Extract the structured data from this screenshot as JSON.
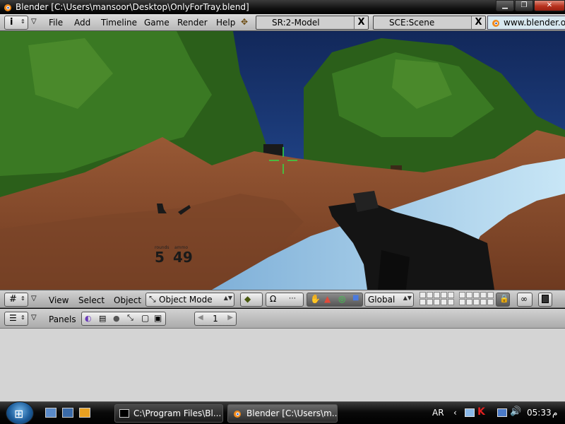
{
  "window": {
    "title": "Blender [C:\\Users\\mansoor\\Desktop\\OnlyForTray.blend]",
    "controls": [
      "minimize-icon",
      "maximize-icon",
      "close-icon"
    ]
  },
  "header": {
    "menus": [
      "File",
      "Add",
      "Timeline",
      "Game",
      "Render",
      "Help"
    ],
    "screen": "SR:2-Model",
    "scene": "SCE:Scene",
    "delete_glyph": "X",
    "url": "www.blender.org"
  },
  "viewport": {
    "hud": {
      "rounds_label": "rounds",
      "rounds_value": "5",
      "ammo_label": "ammo",
      "ammo_value": "49"
    },
    "colors": {
      "sky": "#1c3b7a",
      "tree": "#2f6a1c",
      "ground": "#8a4a2a",
      "water": "#a8d0ea",
      "crosshair": "#33dd44"
    }
  },
  "view3d_header": {
    "menus": [
      "View",
      "Select",
      "Object"
    ],
    "mode": "Object Mode",
    "orientation": "Global"
  },
  "buttons_header": {
    "panels_label": "Panels",
    "frame": "1"
  },
  "taskbar": {
    "tasks": [
      {
        "label": "C:\\Program Files\\Bl...",
        "icon": "terminal-icon"
      },
      {
        "label": "Blender [C:\\Users\\m...",
        "icon": "blender-icon"
      }
    ],
    "language": "AR",
    "time": "05:33",
    "ampm": "م"
  }
}
